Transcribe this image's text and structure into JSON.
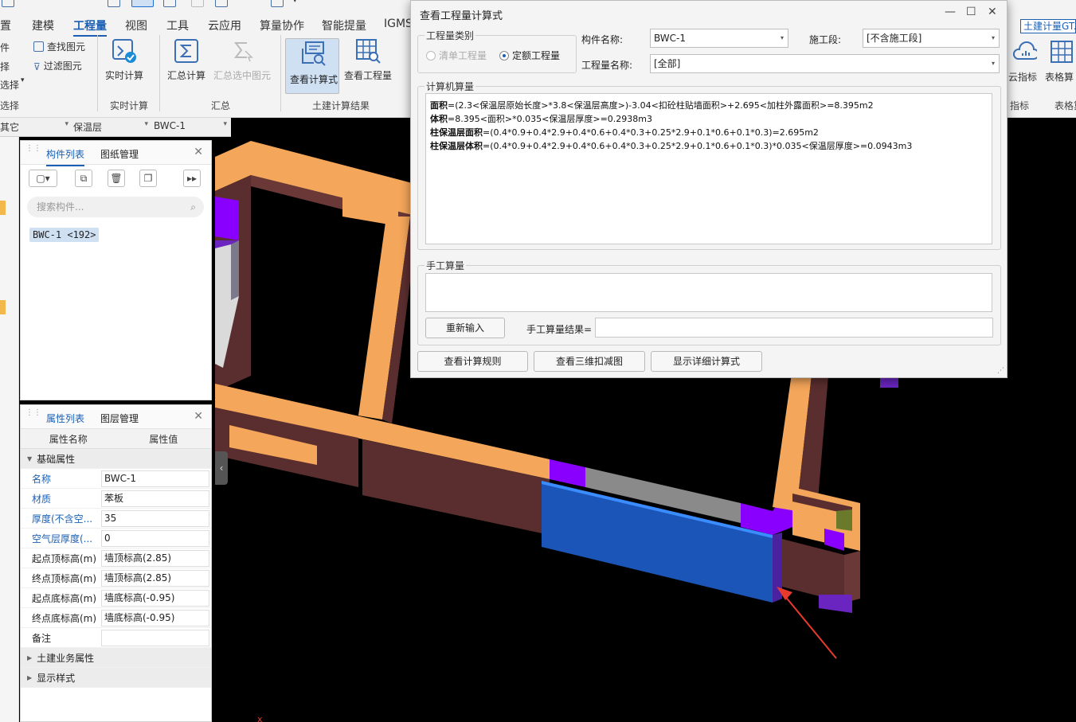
{
  "ribbon": {
    "tabs": [
      "置",
      "建模",
      "工程量",
      "视图",
      "工具",
      "云应用",
      "算量协作",
      "智能提量",
      "IGMS"
    ],
    "active_tab": "工程量",
    "partial_left": {
      "item1": "件",
      "item2": "择",
      "item3": "选择",
      "group": "选择"
    },
    "small_buttons": {
      "find": "查找图元",
      "filter": "过滤图元"
    },
    "buttons": {
      "realtime": "实时计算",
      "summary": "汇总计算",
      "summary_selected": "汇总选中图元",
      "view_formula": "查看计算式",
      "view_quantity": "查看工程量"
    },
    "groups": {
      "realtime": "实时计算",
      "summary": "汇总",
      "results": "土建计算结果"
    },
    "right": {
      "indicator_btn": "云指标",
      "table_btn": "表格算",
      "indicator_group": "指标",
      "table_group": "表格算",
      "dropdown": "土建计量GT..."
    }
  },
  "selector_bar": {
    "c1": "其它",
    "c2": "保温层",
    "c3": "BWC-1"
  },
  "component_panel": {
    "tabs": [
      "构件列表",
      "图纸管理"
    ],
    "search_placeholder": "搜索构件...",
    "item": "BWC-1 <192>"
  },
  "property_panel": {
    "tabs": [
      "属性列表",
      "图层管理"
    ],
    "header": {
      "name": "属性名称",
      "value": "属性值"
    },
    "section_basic": "基础属性",
    "rows": [
      {
        "name": "名称",
        "value": "BWC-1",
        "blue": true
      },
      {
        "name": "材质",
        "value": "苯板",
        "blue": true
      },
      {
        "name": "厚度(不含空...",
        "value": "35",
        "blue": true
      },
      {
        "name": "空气层厚度(...",
        "value": "0",
        "blue": true
      },
      {
        "name": "起点顶标高(m)",
        "value": "墙顶标高(2.85)",
        "blue": false
      },
      {
        "name": "终点顶标高(m)",
        "value": "墙顶标高(2.85)",
        "blue": false
      },
      {
        "name": "起点底标高(m)",
        "value": "墙底标高(-0.95)",
        "blue": false
      },
      {
        "name": "终点底标高(m)",
        "value": "墙底标高(-0.95)",
        "blue": false
      },
      {
        "name": "备注",
        "value": "",
        "blue": false
      }
    ],
    "section_business": "土建业务属性",
    "section_display": "显示样式"
  },
  "dialog": {
    "title": "查看工程量计算式",
    "type_group": "工程量类别",
    "radio_bill": "清单工程量",
    "radio_quota": "定额工程量",
    "label_component": "构件名称:",
    "component_value": "BWC-1",
    "label_section": "施工段:",
    "section_value": "[不含施工段]",
    "label_quantity": "工程量名称:",
    "quantity_value": "[全部]",
    "computer_group": "计算机算量",
    "formulas": [
      {
        "key": "面积",
        "expr": "=(2.3<保温层原始长度>*3.8<保温层高度>)-3.04<扣砼柱贴墙面积>+2.695<加柱外露面积>=8.395m2"
      },
      {
        "key": "体积",
        "expr": "=8.395<面积>*0.035<保温层厚度>=0.2938m3"
      },
      {
        "key": "柱保温层面积",
        "expr": "=(0.4*0.9+0.4*2.9+0.4*0.6+0.4*0.3+0.25*2.9+0.1*0.6+0.1*0.3)=2.695m2"
      },
      {
        "key": "柱保温层体积",
        "expr": "=(0.4*0.9+0.4*2.9+0.4*0.6+0.4*0.3+0.25*2.9+0.1*0.6+0.1*0.3)*0.035<保温层厚度>=0.0943m3"
      }
    ],
    "manual_group": "手工算量",
    "reenter_btn": "重新输入",
    "manual_result_label": "手工算量结果=",
    "btn_rules": "查看计算规则",
    "btn_3d": "查看三维扣减图",
    "btn_detail": "显示详细计算式"
  },
  "canvas": {
    "axis_label": "x"
  }
}
